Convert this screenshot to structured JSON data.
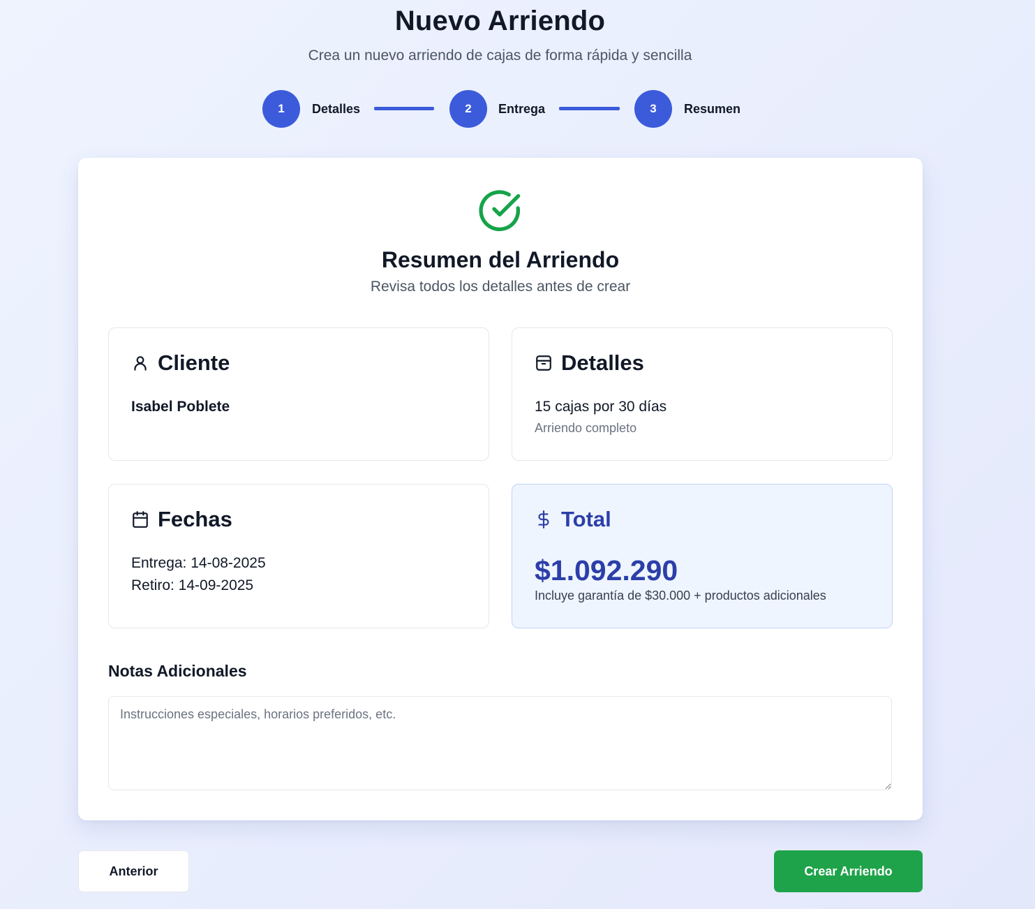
{
  "header": {
    "title": "Nuevo Arriendo",
    "subtitle": "Crea un nuevo arriendo de cajas de forma rápida y sencilla"
  },
  "stepper": {
    "steps": [
      {
        "number": "1",
        "label": "Detalles"
      },
      {
        "number": "2",
        "label": "Entrega"
      },
      {
        "number": "3",
        "label": "Resumen"
      }
    ],
    "accent_color": "#3b5bdb"
  },
  "summary": {
    "icon": "check-circle-icon",
    "title": "Resumen del Arriendo",
    "subtitle": "Revisa todos los detalles antes de crear"
  },
  "cliente": {
    "icon": "user-icon",
    "title": "Cliente",
    "name": "Isabel Poblete"
  },
  "detalles": {
    "icon": "box-icon",
    "title": "Detalles",
    "main": "15 cajas por 30 días",
    "sub": "Arriendo completo"
  },
  "fechas": {
    "icon": "calendar-icon",
    "title": "Fechas",
    "entrega": "Entrega: 14-08-2025",
    "retiro": "Retiro: 14-09-2025"
  },
  "total": {
    "icon": "dollar-icon",
    "title": "Total",
    "amount": "$1.092.290",
    "note": "Incluye garantía de $30.000 + productos adicionales",
    "color": "#2c3fa8"
  },
  "notes": {
    "label": "Notas Adicionales",
    "placeholder": "Instrucciones especiales, horarios preferidos, etc.",
    "value": ""
  },
  "actions": {
    "prev_label": "Anterior",
    "create_label": "Crear Arriendo",
    "create_color": "#1fa34a"
  }
}
